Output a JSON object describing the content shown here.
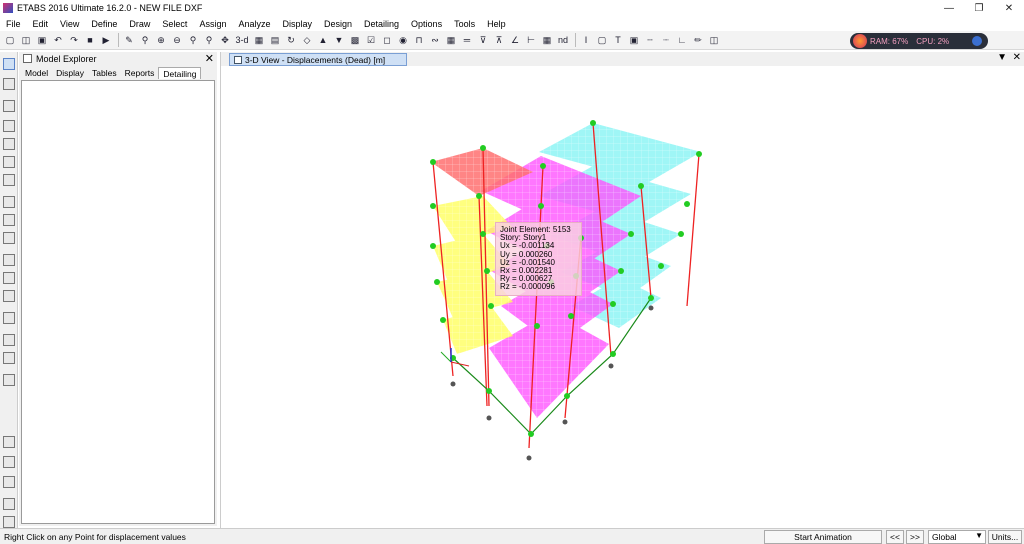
{
  "window": {
    "title": "ETABS 2016 Ultimate 16.2.0 - NEW FILE DXF"
  },
  "menu": [
    "File",
    "Edit",
    "View",
    "Define",
    "Draw",
    "Select",
    "Assign",
    "Analyze",
    "Display",
    "Design",
    "Detailing",
    "Options",
    "Tools",
    "Help"
  ],
  "toolbar": {
    "view3d_label": "3-d",
    "nd_label": "nd"
  },
  "perf": {
    "ram": "RAM: 67%",
    "cpu": "CPU: 2%"
  },
  "explorer": {
    "title": "Model Explorer",
    "tabs": [
      "Model",
      "Display",
      "Tables",
      "Reports",
      "Detailing"
    ],
    "active_tab": "Detailing"
  },
  "view": {
    "tab_title": "3-D View  - Displacements (Dead)  [m]"
  },
  "tooltip": {
    "lines": [
      "Joint Element: 5153",
      "Story: Story1",
      "Ux = -0.001134",
      "Uy = 0.000260",
      "Uz = -0.001540",
      "Rx = 0.002281",
      "Ry = 0.000627",
      "Rz = -0.000096"
    ]
  },
  "status": {
    "message": "Right Click on any Point for displacement values",
    "start_animation": "Start Animation",
    "prev": "<<",
    "next": ">>",
    "coord_system": "Global",
    "units": "Units..."
  },
  "colors": {
    "accent_blue": "#3b6fd0",
    "tab_bg": "#cfe0f5",
    "magenta": "#ff44ff",
    "yellow": "#ffff55",
    "cyan": "#55ffff",
    "red": "#ff6060",
    "green_support": "#33cc33"
  }
}
